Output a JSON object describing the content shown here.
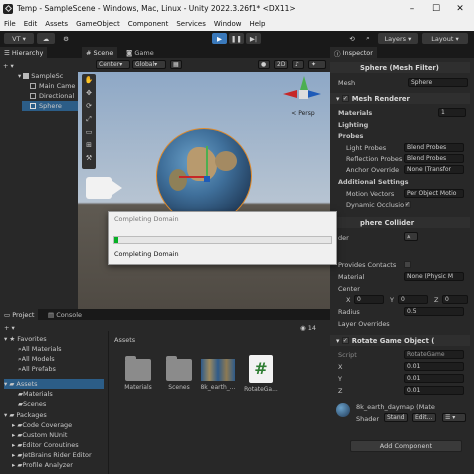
{
  "window": {
    "title": "Temp - SampleScene - Windows, Mac, Linux - Unity 2022.3.26f1* <DX11>",
    "controls": [
      "–",
      "☐",
      "✕"
    ]
  },
  "menu": [
    "File",
    "Edit",
    "Assets",
    "GameObject",
    "Component",
    "Services",
    "Window",
    "Help"
  ],
  "toolbar": {
    "account": "VT ▾",
    "layers": "Layers",
    "layout": "Layout"
  },
  "hierarchy": {
    "tab": "Hierarchy",
    "items": [
      "SampleSc",
      "Main Came",
      "Directional",
      "Sphere"
    ]
  },
  "scene": {
    "tabs": [
      "Scene",
      "Game"
    ],
    "pivot": "Center",
    "space": "Global",
    "mode2d": "2D",
    "gizmo_label": "< Persp"
  },
  "dialog": {
    "title": "Completing Domain",
    "status": "Completing Domain",
    "progress": 0.02
  },
  "inspector": {
    "tab": "Inspector",
    "mesh_filter": {
      "title": "Sphere (Mesh Filter)",
      "label": "Mesh",
      "value": "Sphere"
    },
    "mesh_renderer": {
      "title": "Mesh Renderer",
      "materials_label": "Materials",
      "materials_count": "1",
      "lighting_label": "Lighting",
      "probes_label": "Probes",
      "light_probes_label": "Light Probes",
      "light_probes_value": "Blend Probes",
      "reflection_probes_label": "Reflection Probes",
      "reflection_probes_value": "Blend Probes",
      "anchor_override_label": "Anchor Override",
      "anchor_override_value": "None (Transfor",
      "additional_settings_label": "Additional Settings",
      "motion_vectors_label": "Motion Vectors",
      "motion_vectors_value": "Per Object Motio",
      "dynamic_occlusion_label": "Dynamic Occlusio"
    },
    "sphere_collider": {
      "title": "phere Collider",
      "edit_label": "der",
      "provides_contacts_label": "Provides Contacts",
      "material_label": "Material",
      "material_value": "None (Physic M",
      "center_label": "Center",
      "center": {
        "x": "0",
        "y": "0",
        "z": "0"
      },
      "radius_label": "Radius",
      "radius_value": "0.5",
      "layer_overrides_label": "Layer Overrides"
    },
    "rotate": {
      "title": "Rotate Game Object (",
      "script_label": "Script",
      "script_value": "RotateGame",
      "x_label": "X",
      "x_value": "0.01",
      "y_label": "Y",
      "y_value": "0.01",
      "z_label": "Z",
      "z_value": "0.01"
    },
    "material": {
      "name": "8k_earth_daymap (Mate",
      "shader_label": "Shader",
      "shader_value": "Stand",
      "edit_label": "Edit..."
    },
    "add_component": "Add Component"
  },
  "project": {
    "tabs": [
      "Project",
      "Console"
    ],
    "count": "14",
    "favorites": {
      "label": "Favorites",
      "items": [
        "All Materials",
        "All Models",
        "All Prefabs"
      ]
    },
    "assets_label": "Assets",
    "asset_folders": [
      "Materials",
      "Scenes"
    ],
    "packages": {
      "label": "Packages",
      "items": [
        "Code Coverage",
        "Custom NUnit",
        "Editor Coroutines",
        "JetBrains Rider Editor",
        "Profile Analyzer"
      ]
    },
    "grid_title": "Assets",
    "grid_items": [
      "Materials",
      "Scenes",
      "8k_earth_...",
      "RotateGa..."
    ]
  },
  "colors": {
    "accent": "#3a79bb",
    "panel": "#282828",
    "sky": "#8ea8c6",
    "ground": "#5f5a52"
  }
}
